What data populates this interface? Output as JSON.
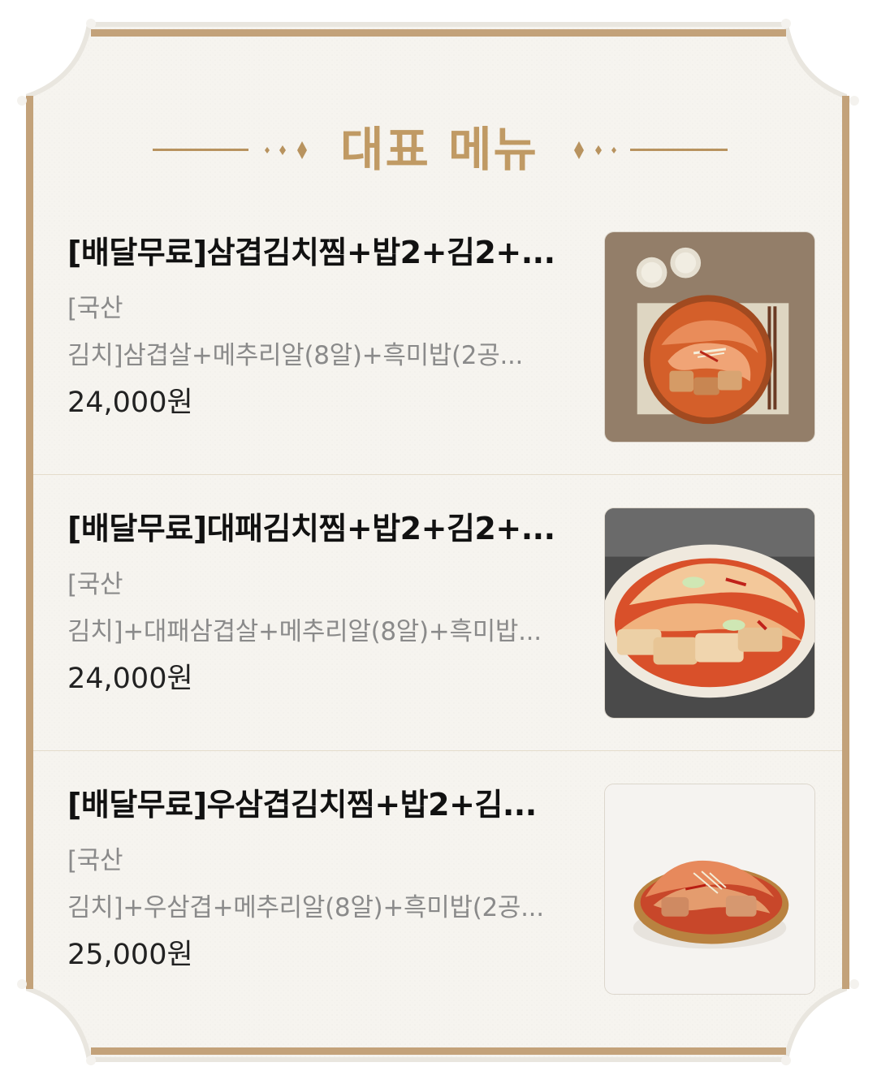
{
  "section": {
    "title": "대표 메뉴",
    "colors": {
      "gold": "#b8935f",
      "title_gold": "#c09a64",
      "paper": "#f6f4ef"
    }
  },
  "menu_items": [
    {
      "name": "[배달무료]삼겹김치찜+밥2+김2+...",
      "desc_line1": "[국산",
      "desc_line2": "김치]삼겹살+메추리알(8알)+흑미밥(2공...",
      "price": "24,000원",
      "image_icon": "pork-belly-kimchi-stew-photo"
    },
    {
      "name": "[배달무료]대패김치찜+밥2+김2+...",
      "desc_line1": "[국산",
      "desc_line2": "김치]+대패삼겹살+메추리알(8알)+흑미밥...",
      "price": "24,000원",
      "image_icon": "thin-sliced-pork-kimchi-stew-photo"
    },
    {
      "name": "[배달무료]우삼겹김치찜+밥2+김...",
      "desc_line1": "[국산",
      "desc_line2": "김치]+우삼겹+메추리알(8알)+흑미밥(2공...",
      "price": "25,000원",
      "image_icon": "beef-brisket-kimchi-stew-photo"
    }
  ]
}
